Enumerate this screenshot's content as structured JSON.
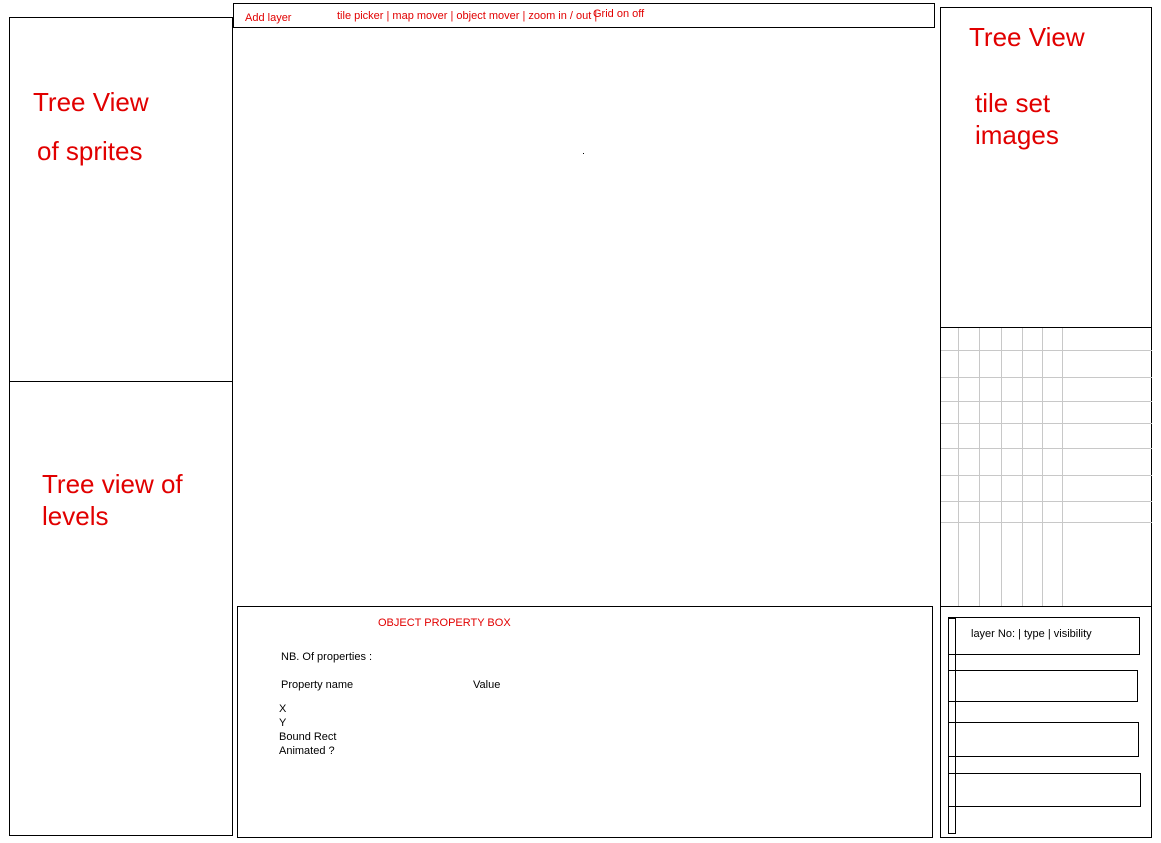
{
  "toolbar": {
    "add_layer": "Add layer",
    "tools": "tile picker | map mover | object mover | zoom in / out |",
    "grid_toggle": "Grid on off"
  },
  "left_top": {
    "line1": "Tree View",
    "line2": "of sprites"
  },
  "left_bottom": {
    "line1": "Tree view of",
    "line2": "levels"
  },
  "right_top": {
    "title": "Tree View",
    "line1": "tile set",
    "line2": "images"
  },
  "property_box": {
    "title": "OBJECT PROPERTY BOX",
    "count_label": "NB. Of properties :",
    "col_name": "Property name",
    "col_value": "Value",
    "properties": [
      "X",
      "Y",
      "Bound Rect",
      "Animated ?"
    ]
  },
  "layers_panel": {
    "header": "layer No:  |  type   |   visibility"
  },
  "colors": {
    "accent_text": "#e10000",
    "border": "#000000",
    "grid": "#c8c8c8"
  }
}
